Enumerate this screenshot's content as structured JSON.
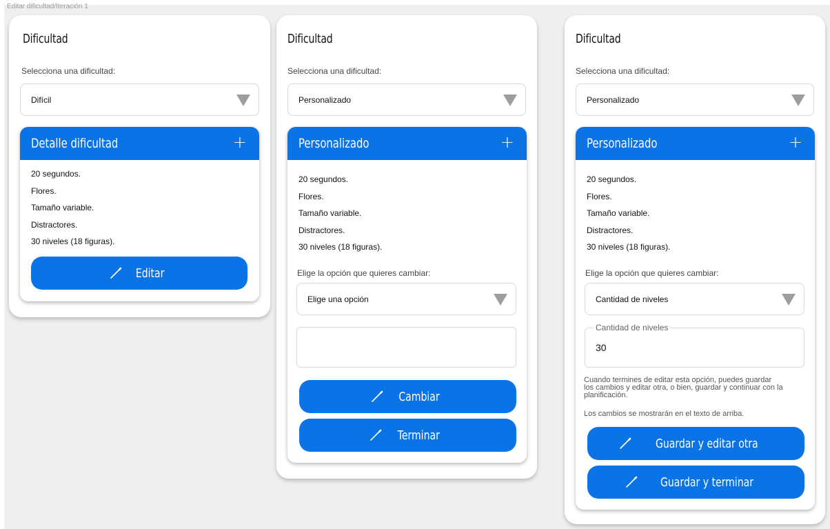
{
  "frame_label": "Editar dificultad/Iteración 1",
  "colors": {
    "accent": "#0a74e6",
    "canvas": "#efefef"
  },
  "cards": [
    {
      "title": "Dificultad",
      "select_label": "Selecciona una dificultad:",
      "select_value": "Difícil",
      "panel_title": "Detalle dificultad",
      "details": [
        "20 segundos.",
        "Flores.",
        "Tamaño variable.",
        "Distractores.",
        "30 niveles (18 figuras)."
      ],
      "button": "Editar"
    },
    {
      "title": "Dificultad",
      "select_label": "Selecciona una dificultad:",
      "select_value": "Personalizado",
      "panel_title": "Personalizado",
      "details": [
        "20 segundos.",
        "Flores.",
        "Tamaño variable.",
        "Distractores.",
        "30 niveles (18 figuras)."
      ],
      "option_label": "Elige la opción que quieres cambiar:",
      "option_value": "Elige una opción",
      "buttons": [
        "Cambiar",
        "Terminar"
      ]
    },
    {
      "title": "Dificultad",
      "select_label": "Selecciona una dificultad:",
      "select_value": "Personalizado",
      "panel_title": "Personalizado",
      "details": [
        "20 segundos.",
        "Flores.",
        "Tamaño variable.",
        "Distractores.",
        "30 niveles (18 figuras)."
      ],
      "option_label": "Elige la opción que quieres cambiar:",
      "option_value": "Cantidad de niveles",
      "field_label": "Cantidad de niveles",
      "field_value": "30",
      "help_lines": [
        "Cuando termines de editar esta opción, puedes guardar",
        "los cambios y editar otra, o bien, guardar y continuar con la",
        "planificación."
      ],
      "help_2": "Los cambios se mostrarán en el texto de arriba.",
      "buttons": [
        "Guardar y editar otra",
        "Guardar y terminar"
      ]
    }
  ],
  "icons": {
    "panel_toggle": "plus-icon",
    "select_arrow": "triangle-down-icon",
    "button_icon": "pencil-icon"
  }
}
